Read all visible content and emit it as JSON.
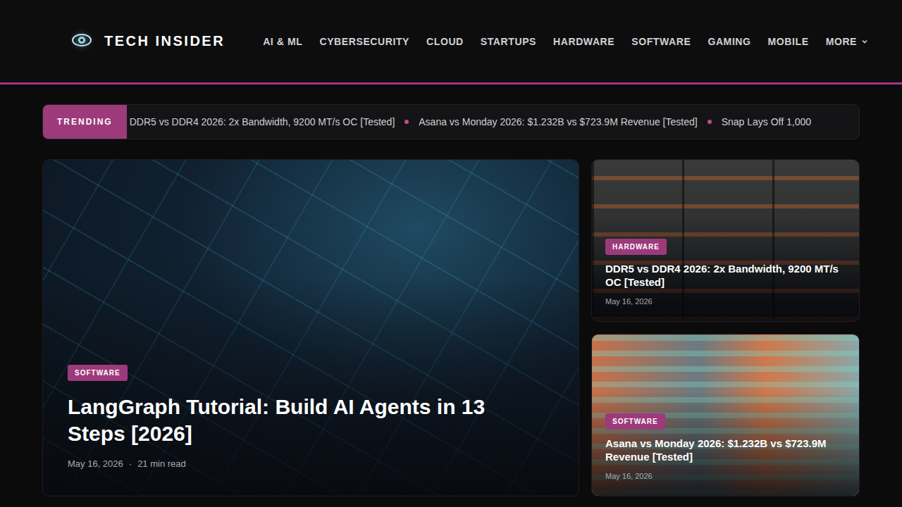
{
  "header": {
    "logo": "TECH INSIDER",
    "nav": [
      "AI & ML",
      "CYBERSECURITY",
      "CLOUD",
      "STARTUPS",
      "HARDWARE",
      "SOFTWARE",
      "GAMING",
      "MOBILE",
      "MORE"
    ]
  },
  "trending": {
    "label": "TRENDING",
    "items": [
      "DDR5 vs DDR4 2026: 2x Bandwidth, 9200 MT/s OC [Tested]",
      "Asana vs Monday 2026: $1.232B vs $723.9M Revenue [Tested]",
      "Snap Lays Off 1,000"
    ]
  },
  "featured": {
    "category": "SOFTWARE",
    "title": "LangGraph Tutorial: Build AI Agents in 13 Steps [2026]",
    "date": "May 16, 2026",
    "separator": "·",
    "read_time": "21 min read"
  },
  "side": [
    {
      "category": "HARDWARE",
      "title": "DDR5 vs DDR4 2026: 2x Bandwidth, 9200 MT/s OC [Tested]",
      "date": "May 16, 2026"
    },
    {
      "category": "SOFTWARE",
      "title": "Asana vs Monday 2026: $1.232B vs $723.9M Revenue [Tested]",
      "date": "May 16, 2026"
    }
  ]
}
